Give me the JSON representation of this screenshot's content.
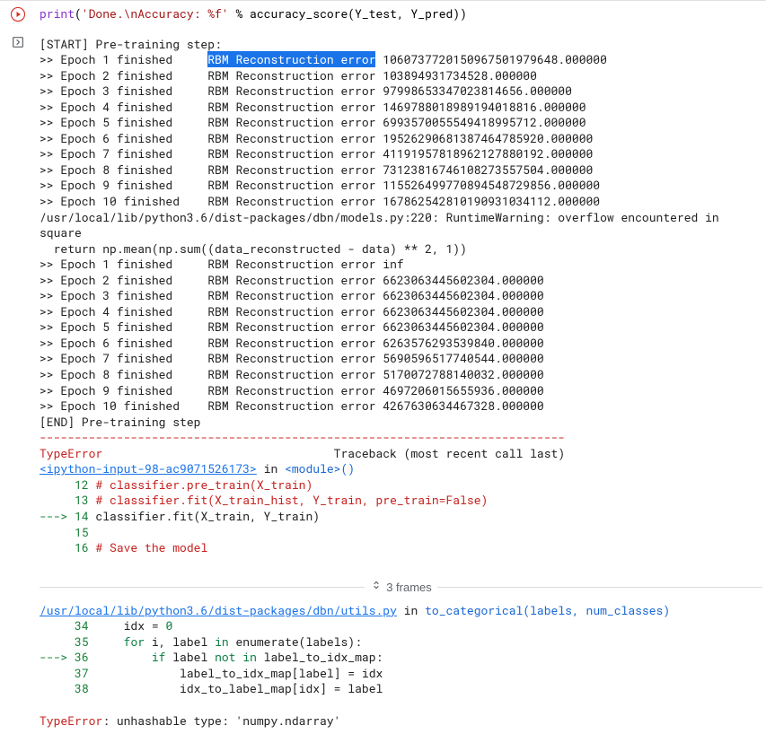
{
  "input_cell": {
    "code_tokens": [
      {
        "t": "print",
        "cls": "c-purple"
      },
      {
        "t": "(",
        "cls": ""
      },
      {
        "t": "'Done.\\nAccuracy: %f'",
        "cls": "builtin"
      },
      {
        "t": " % accuracy_score(Y_test, Y_pred))",
        "cls": ""
      }
    ]
  },
  "output": {
    "start_line": "[START] Pre-training step:",
    "epochs_block1": [
      {
        "ep": "1",
        "err": "106073772015096750197964​8.000000"
      },
      {
        "ep": "2",
        "err": "103894931734528.000000"
      },
      {
        "ep": "3",
        "err": "97998653347023814656.000000"
      },
      {
        "ep": "4",
        "err": "14697880189891940188​16.000000"
      },
      {
        "ep": "5",
        "err": "69935700555494189957​12.000000"
      },
      {
        "ep": "6",
        "err": "19526290681387464785920.000000"
      },
      {
        "ep": "7",
        "err": "41191957818962127880192.000000"
      },
      {
        "ep": "8",
        "err": "73123816746108273557504.000000"
      },
      {
        "ep": "9",
        "err": "115526499770894548729856.000000"
      },
      {
        "ep": "10",
        "err": "167862542810190931034112.000000"
      }
    ],
    "warn_line1": "/usr/local/lib/python3.6/dist-packages/dbn/models.py:220: RuntimeWarning: overflow encountered in square",
    "warn_line2": "  return np.mean(np.sum((data_reconstructed - data) ** 2, 1))",
    "epochs_block2": [
      {
        "ep": "1",
        "err": "inf"
      },
      {
        "ep": "2",
        "err": "6623063445602304.000000"
      },
      {
        "ep": "3",
        "err": "6623063445602304.000000"
      },
      {
        "ep": "4",
        "err": "6623063445602304.000000"
      },
      {
        "ep": "5",
        "err": "6623063445602304.000000"
      },
      {
        "ep": "6",
        "err": "6263576293539840.000000"
      },
      {
        "ep": "7",
        "err": "5690596517740544.000000"
      },
      {
        "ep": "8",
        "err": "5170072788140032.000000"
      },
      {
        "ep": "9",
        "err": "4697206015655936.000000"
      },
      {
        "ep": "10",
        "err": "4267630634467328.000000"
      }
    ],
    "end_line": "[END] Pre-training step",
    "dashes": "---------------------------------------------------------------------------",
    "error_type": "TypeError",
    "traceback_label": "Traceback (most recent call last)",
    "frame1_link": "<ipython-input-98-ac9071526173>",
    "frame1_in": " in ",
    "frame1_module": "<module>",
    "frame1_paren": "()",
    "code_lines_1": [
      {
        "num": "12",
        "prefix": "     ",
        "arrow": "",
        "text": "# classifier.pre_train(X_train)",
        "cls": "c-red"
      },
      {
        "num": "13",
        "prefix": "     ",
        "arrow": "",
        "text": "# classifier.fit(X_train_hist, Y_train, pre_train=False)",
        "cls": "c-red"
      },
      {
        "num": "14",
        "prefix": "",
        "arrow": "---> ",
        "text": "classifier.fit(X_train, Y_train)",
        "cls": ""
      },
      {
        "num": "15",
        "prefix": "     ",
        "arrow": "",
        "text": "",
        "cls": ""
      },
      {
        "num": "16",
        "prefix": "     ",
        "arrow": "",
        "text": "# Save the model",
        "cls": "c-red"
      }
    ],
    "frames_label": "3 frames",
    "frame2_link": "/usr/local/lib/python3.6/dist-packages/dbn/utils.py",
    "frame2_in": " in ",
    "frame2_func": "to_categorical",
    "frame2_args": "(labels, num_classes)",
    "code_lines_2": [
      {
        "num": "34",
        "arrow": "     ",
        "tokens": [
          {
            "t": "    idx ",
            "c": ""
          },
          {
            "t": "=",
            "c": ""
          },
          {
            "t": " ",
            "c": ""
          },
          {
            "t": "0",
            "c": "c-teal"
          }
        ]
      },
      {
        "num": "35",
        "arrow": "     ",
        "tokens": [
          {
            "t": "    ",
            "c": ""
          },
          {
            "t": "for",
            "c": "c-teal"
          },
          {
            "t": " i, label ",
            "c": ""
          },
          {
            "t": "in",
            "c": "c-teal"
          },
          {
            "t": " enumerate(labels):",
            "c": ""
          }
        ]
      },
      {
        "num": "36",
        "arrow": "---> ",
        "tokens": [
          {
            "t": "        ",
            "c": ""
          },
          {
            "t": "if",
            "c": "c-teal"
          },
          {
            "t": " label ",
            "c": ""
          },
          {
            "t": "not in",
            "c": "c-teal"
          },
          {
            "t": " label_to_idx_map:",
            "c": ""
          }
        ]
      },
      {
        "num": "37",
        "arrow": "     ",
        "tokens": [
          {
            "t": "            label_to_idx_map[label] ",
            "c": ""
          },
          {
            "t": "=",
            "c": ""
          },
          {
            "t": " idx",
            "c": ""
          }
        ]
      },
      {
        "num": "38",
        "arrow": "     ",
        "tokens": [
          {
            "t": "            idx_to_label_map[idx] ",
            "c": ""
          },
          {
            "t": "=",
            "c": ""
          },
          {
            "t": " label",
            "c": ""
          }
        ]
      }
    ],
    "final_err_type": "TypeError",
    "final_err_msg": ": unhashable type: 'numpy.ndarray'"
  },
  "highlighted_text": "RBM Reconstruction error"
}
